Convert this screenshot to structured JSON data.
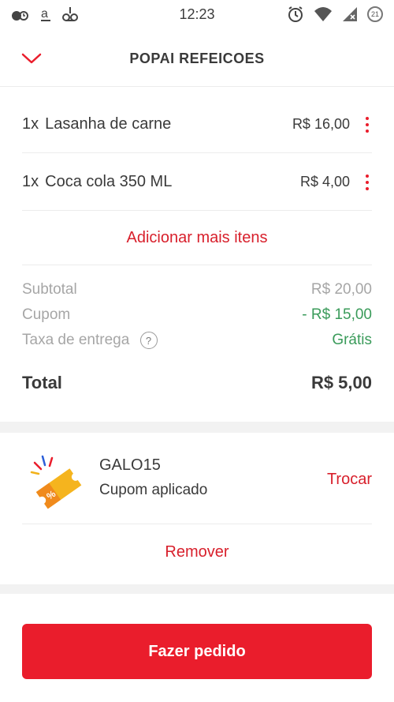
{
  "status_bar": {
    "time": "12:23",
    "left_icons": [
      "notification-icon",
      "amazon-icon",
      "voicemail-icon"
    ],
    "battery": "21"
  },
  "header": {
    "title": "POPAI REFEICOES",
    "back_icon": "chevron-down-icon"
  },
  "items": [
    {
      "qty": "1x",
      "name": "Lasanha de carne",
      "price": "R$ 16,00"
    },
    {
      "qty": "1x",
      "name": "Coca cola 350 ML",
      "price": "R$ 4,00"
    }
  ],
  "add_more_label": "Adicionar mais itens",
  "summary": {
    "subtotal_label": "Subtotal",
    "subtotal_value": "R$ 20,00",
    "coupon_label": "Cupom",
    "coupon_value": "- R$ 15,00",
    "delivery_label": "Taxa de entrega",
    "delivery_value": "Grátis",
    "help_symbol": "?",
    "total_label": "Total",
    "total_value": "R$ 5,00"
  },
  "coupon": {
    "code": "GALO15",
    "status": "Cupom aplicado",
    "change_label": "Trocar",
    "remove_label": "Remover"
  },
  "order_button_label": "Fazer pedido",
  "colors": {
    "accent": "#ea1d2c",
    "green": "#3a9b5a",
    "muted": "#a6a6a6"
  }
}
